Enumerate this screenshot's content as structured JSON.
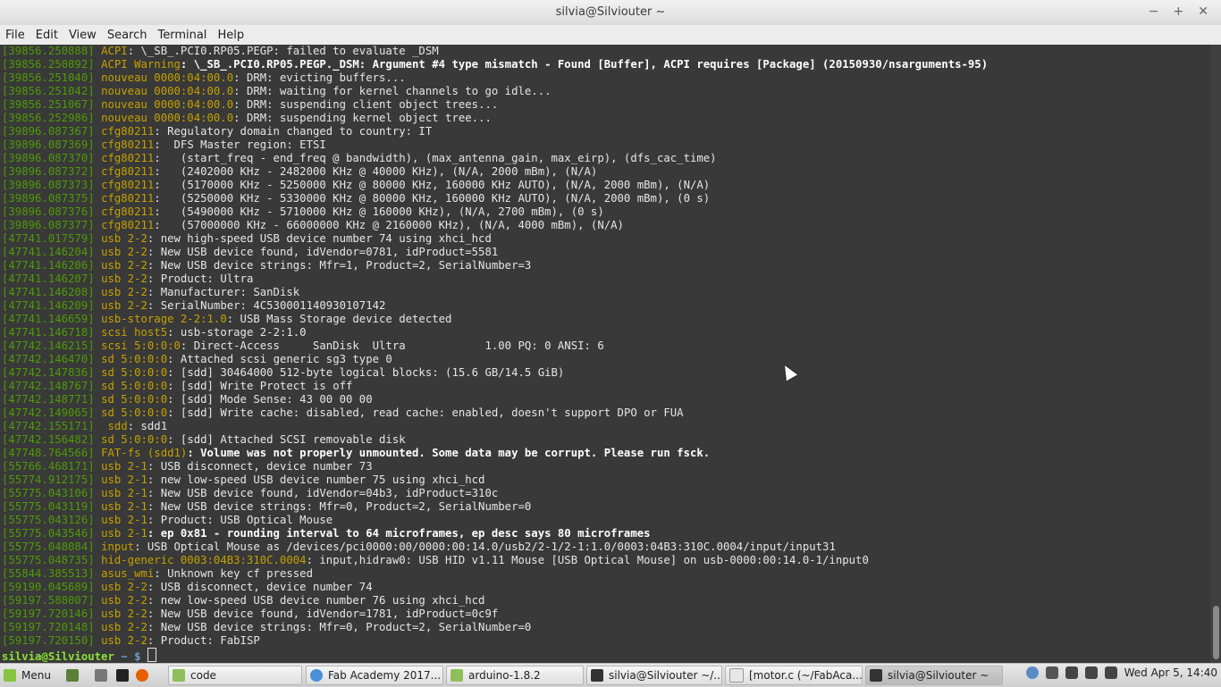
{
  "window": {
    "title": "silvia@Silviouter ~",
    "buttons": [
      "−",
      "+",
      "✕"
    ]
  },
  "menu": [
    "File",
    "Edit",
    "View",
    "Search",
    "Terminal",
    "Help"
  ],
  "terminal": {
    "lines": [
      {
        "ts": "[39856.250888]",
        "src": "ACPI",
        "msg": ": \\_SB_.PCI0.RP05.PEGP: failed to evaluate _DSM"
      },
      {
        "ts": "[39856.250892]",
        "src": "ACPI Warning",
        "msg": ": \\_SB_.PCI0.RP05.PEGP._DSM: Argument #4 type mismatch - Found [Buffer], ACPI requires [Package] (20150930/nsarguments-95)",
        "bold": true
      },
      {
        "ts": "[39856.251040]",
        "src": "nouveau 0000:04:00.0",
        "msg": ": DRM: evicting buffers..."
      },
      {
        "ts": "[39856.251042]",
        "src": "nouveau 0000:04:00.0",
        "msg": ": DRM: waiting for kernel channels to go idle..."
      },
      {
        "ts": "[39856.251067]",
        "src": "nouveau 0000:04:00.0",
        "msg": ": DRM: suspending client object trees..."
      },
      {
        "ts": "[39856.252986]",
        "src": "nouveau 0000:04:00.0",
        "msg": ": DRM: suspending kernel object tree..."
      },
      {
        "ts": "[39896.087367]",
        "src": "cfg80211",
        "msg": ": Regulatory domain changed to country: IT"
      },
      {
        "ts": "[39896.087369]",
        "src": "cfg80211",
        "msg": ":  DFS Master region: ETSI"
      },
      {
        "ts": "[39896.087370]",
        "src": "cfg80211",
        "msg": ":   (start_freq - end_freq @ bandwidth), (max_antenna_gain, max_eirp), (dfs_cac_time)"
      },
      {
        "ts": "[39896.087372]",
        "src": "cfg80211",
        "msg": ":   (2402000 KHz - 2482000 KHz @ 40000 KHz), (N/A, 2000 mBm), (N/A)"
      },
      {
        "ts": "[39896.087373]",
        "src": "cfg80211",
        "msg": ":   (5170000 KHz - 5250000 KHz @ 80000 KHz, 160000 KHz AUTO), (N/A, 2000 mBm), (N/A)"
      },
      {
        "ts": "[39896.087375]",
        "src": "cfg80211",
        "msg": ":   (5250000 KHz - 5330000 KHz @ 80000 KHz, 160000 KHz AUTO), (N/A, 2000 mBm), (0 s)"
      },
      {
        "ts": "[39896.087376]",
        "src": "cfg80211",
        "msg": ":   (5490000 KHz - 5710000 KHz @ 160000 KHz), (N/A, 2700 mBm), (0 s)"
      },
      {
        "ts": "[39896.087377]",
        "src": "cfg80211",
        "msg": ":   (57000000 KHz - 66000000 KHz @ 2160000 KHz), (N/A, 4000 mBm), (N/A)"
      },
      {
        "ts": "[47741.017579]",
        "src": "usb 2-2",
        "msg": ": new high-speed USB device number 74 using xhci_hcd"
      },
      {
        "ts": "[47741.146204]",
        "src": "usb 2-2",
        "msg": ": New USB device found, idVendor=0781, idProduct=5581"
      },
      {
        "ts": "[47741.146206]",
        "src": "usb 2-2",
        "msg": ": New USB device strings: Mfr=1, Product=2, SerialNumber=3"
      },
      {
        "ts": "[47741.146207]",
        "src": "usb 2-2",
        "msg": ": Product: Ultra"
      },
      {
        "ts": "[47741.146208]",
        "src": "usb 2-2",
        "msg": ": Manufacturer: SanDisk"
      },
      {
        "ts": "[47741.146209]",
        "src": "usb 2-2",
        "msg": ": SerialNumber: 4C530001140930107142"
      },
      {
        "ts": "[47741.146659]",
        "src": "usb-storage 2-2:1.0",
        "msg": ": USB Mass Storage device detected"
      },
      {
        "ts": "[47741.146718]",
        "src": "scsi host5",
        "msg": ": usb-storage 2-2:1.0"
      },
      {
        "ts": "[47742.146215]",
        "src": "scsi 5:0:0:0",
        "msg": ": Direct-Access     SanDisk  Ultra            1.00 PQ: 0 ANSI: 6"
      },
      {
        "ts": "[47742.146470]",
        "src": "sd 5:0:0:0",
        "msg": ": Attached scsi generic sg3 type 0"
      },
      {
        "ts": "[47742.147836]",
        "src": "sd 5:0:0:0",
        "msg": ": [sdd] 30464000 512-byte logical blocks: (15.6 GB/14.5 GiB)"
      },
      {
        "ts": "[47742.148767]",
        "src": "sd 5:0:0:0",
        "msg": ": [sdd] Write Protect is off"
      },
      {
        "ts": "[47742.148771]",
        "src": "sd 5:0:0:0",
        "msg": ": [sdd] Mode Sense: 43 00 00 00"
      },
      {
        "ts": "[47742.149065]",
        "src": "sd 5:0:0:0",
        "msg": ": [sdd] Write cache: disabled, read cache: enabled, doesn't support DPO or FUA"
      },
      {
        "ts": "[47742.155171]",
        "src": " sdd",
        "msg": ": sdd1"
      },
      {
        "ts": "[47742.156482]",
        "src": "sd 5:0:0:0",
        "msg": ": [sdd] Attached SCSI removable disk"
      },
      {
        "ts": "[47748.764566]",
        "src": "FAT-fs (sdd1)",
        "msg": ": Volume was not properly unmounted. Some data may be corrupt. Please run fsck.",
        "bold": true
      },
      {
        "ts": "[55766.468171]",
        "src": "usb 2-1",
        "msg": ": USB disconnect, device number 73"
      },
      {
        "ts": "[55774.912175]",
        "src": "usb 2-1",
        "msg": ": new low-speed USB device number 75 using xhci_hcd"
      },
      {
        "ts": "[55775.043106]",
        "src": "usb 2-1",
        "msg": ": New USB device found, idVendor=04b3, idProduct=310c"
      },
      {
        "ts": "[55775.043119]",
        "src": "usb 2-1",
        "msg": ": New USB device strings: Mfr=0, Product=2, SerialNumber=0"
      },
      {
        "ts": "[55775.043126]",
        "src": "usb 2-1",
        "msg": ": Product: USB Optical Mouse"
      },
      {
        "ts": "[55775.043546]",
        "src": "usb 2-1",
        "msg": ": ep 0x81 - rounding interval to 64 microframes, ep desc says 80 microframes",
        "bold": true
      },
      {
        "ts": "[55775.048084]",
        "src": "input",
        "msg": ": USB Optical Mouse as /devices/pci0000:00/0000:00:14.0/usb2/2-1/2-1:1.0/0003:04B3:310C.0004/input/input31"
      },
      {
        "ts": "[55775.048735]",
        "src": "hid-generic 0003:04B3:310C.0004",
        "msg": ": input,hidraw0: USB HID v1.11 Mouse [USB Optical Mouse] on usb-0000:00:14.0-1/input0"
      },
      {
        "ts": "[55844.385513]",
        "src": "asus_wmi",
        "msg": ": Unknown key cf pressed"
      },
      {
        "ts": "[59190.045689]",
        "src": "usb 2-2",
        "msg": ": USB disconnect, device number 74"
      },
      {
        "ts": "[59197.588007]",
        "src": "usb 2-2",
        "msg": ": new low-speed USB device number 76 using xhci_hcd"
      },
      {
        "ts": "[59197.720146]",
        "src": "usb 2-2",
        "msg": ": New USB device found, idVendor=1781, idProduct=0c9f"
      },
      {
        "ts": "[59197.720148]",
        "src": "usb 2-2",
        "msg": ": New USB device strings: Mfr=0, Product=2, SerialNumber=0"
      },
      {
        "ts": "[59197.720150]",
        "src": "usb 2-2",
        "msg": ": Product: FabISP"
      }
    ],
    "prompt_user": "silvia@Silviouter",
    "prompt_path": " ~ $ "
  },
  "taskbar": {
    "menu_label": "Menu",
    "tasks": [
      {
        "label": "code",
        "icon": "folder-icon",
        "color": "#8fbf5a"
      },
      {
        "label": "Fab Academy 2017...",
        "icon": "chrome-icon",
        "color": "#4a8fd8"
      },
      {
        "label": "arduino-1.8.2",
        "icon": "folder-icon",
        "color": "#8fbf5a"
      },
      {
        "label": "silvia@Silviouter ~/...",
        "icon": "terminal-icon",
        "color": "#333333"
      },
      {
        "label": "[motor.c (~/FabAca...",
        "icon": "text-editor-icon",
        "color": "#e7e7e7"
      },
      {
        "label": "silvia@Silviouter ~",
        "icon": "terminal-icon",
        "color": "#333333",
        "active": true
      }
    ],
    "clock": "Wed Apr  5, 14:40"
  },
  "colors": {
    "timestamp": "#4e9a06",
    "source": "#c4a000",
    "background": "#393939"
  }
}
